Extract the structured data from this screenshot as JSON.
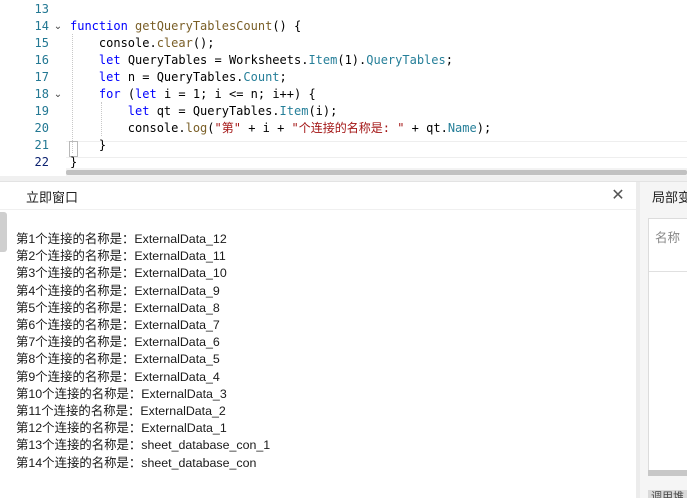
{
  "editor": {
    "lines": [
      {
        "num": "13",
        "tokens": [
          {
            "t": ""
          }
        ]
      },
      {
        "num": "14",
        "fold": "⌄",
        "tokens": [
          {
            "t": "function ",
            "c": "kw"
          },
          {
            "t": "getQueryTablesCount",
            "c": "fn"
          },
          {
            "t": "() {"
          }
        ]
      },
      {
        "num": "15",
        "tokens": [
          {
            "t": "    console."
          },
          {
            "t": "clear",
            "c": "fn"
          },
          {
            "t": "();"
          }
        ]
      },
      {
        "num": "16",
        "tokens": [
          {
            "t": "    "
          },
          {
            "t": "let ",
            "c": "kw"
          },
          {
            "t": "QueryTables = Worksheets."
          },
          {
            "t": "Item",
            "c": "mem"
          },
          {
            "t": "(1)."
          },
          {
            "t": "QueryTables",
            "c": "mem"
          },
          {
            "t": ";"
          }
        ]
      },
      {
        "num": "17",
        "tokens": [
          {
            "t": "    "
          },
          {
            "t": "let ",
            "c": "kw"
          },
          {
            "t": "n = QueryTables."
          },
          {
            "t": "Count",
            "c": "mem"
          },
          {
            "t": ";"
          }
        ]
      },
      {
        "num": "18",
        "fold": "⌄",
        "tokens": [
          {
            "t": "    "
          },
          {
            "t": "for ",
            "c": "kw"
          },
          {
            "t": "("
          },
          {
            "t": "let ",
            "c": "kw"
          },
          {
            "t": "i = 1; i <= n; i++) {"
          }
        ]
      },
      {
        "num": "19",
        "tokens": [
          {
            "t": "        "
          },
          {
            "t": "let ",
            "c": "kw"
          },
          {
            "t": "qt = QueryTables."
          },
          {
            "t": "Item",
            "c": "mem"
          },
          {
            "t": "(i);"
          }
        ]
      },
      {
        "num": "20",
        "tokens": [
          {
            "t": "        console."
          },
          {
            "t": "log",
            "c": "fn"
          },
          {
            "t": "("
          },
          {
            "t": "\"第\"",
            "c": "str"
          },
          {
            "t": " + i + "
          },
          {
            "t": "\"个连接的名称是: \"",
            "c": "str"
          },
          {
            "t": " + qt."
          },
          {
            "t": "Name",
            "c": "mem"
          },
          {
            "t": ");"
          }
        ]
      },
      {
        "num": "21",
        "tokens": [
          {
            "t": "    }"
          }
        ]
      },
      {
        "num": "22",
        "active": true,
        "tokens": [
          {
            "t": "}"
          }
        ]
      }
    ]
  },
  "immediate": {
    "title": "立即窗口",
    "close_glyph": "✕",
    "output": [
      "第1个连接的名称是：ExternalData_12",
      "第2个连接的名称是：ExternalData_11",
      "第3个连接的名称是：ExternalData_10",
      "第4个连接的名称是：ExternalData_9",
      "第5个连接的名称是：ExternalData_8",
      "第6个连接的名称是：ExternalData_7",
      "第7个连接的名称是：ExternalData_6",
      "第8个连接的名称是：ExternalData_5",
      "第9个连接的名称是：ExternalData_4",
      "第10个连接的名称是：ExternalData_3",
      "第11个连接的名称是：ExternalData_2",
      "第12个连接的名称是：ExternalData_1",
      "第13个连接的名称是：sheet_database_con_1",
      "第14个连接的名称是：sheet_database_con"
    ]
  },
  "locals": {
    "title": "局部变",
    "column_name": "名称",
    "bottom_tab": "调用堆"
  },
  "colors": {
    "keyword": "#0000ff",
    "function": "#795e26",
    "member": "#267f99",
    "string": "#a31515",
    "line_number": "#237893"
  }
}
